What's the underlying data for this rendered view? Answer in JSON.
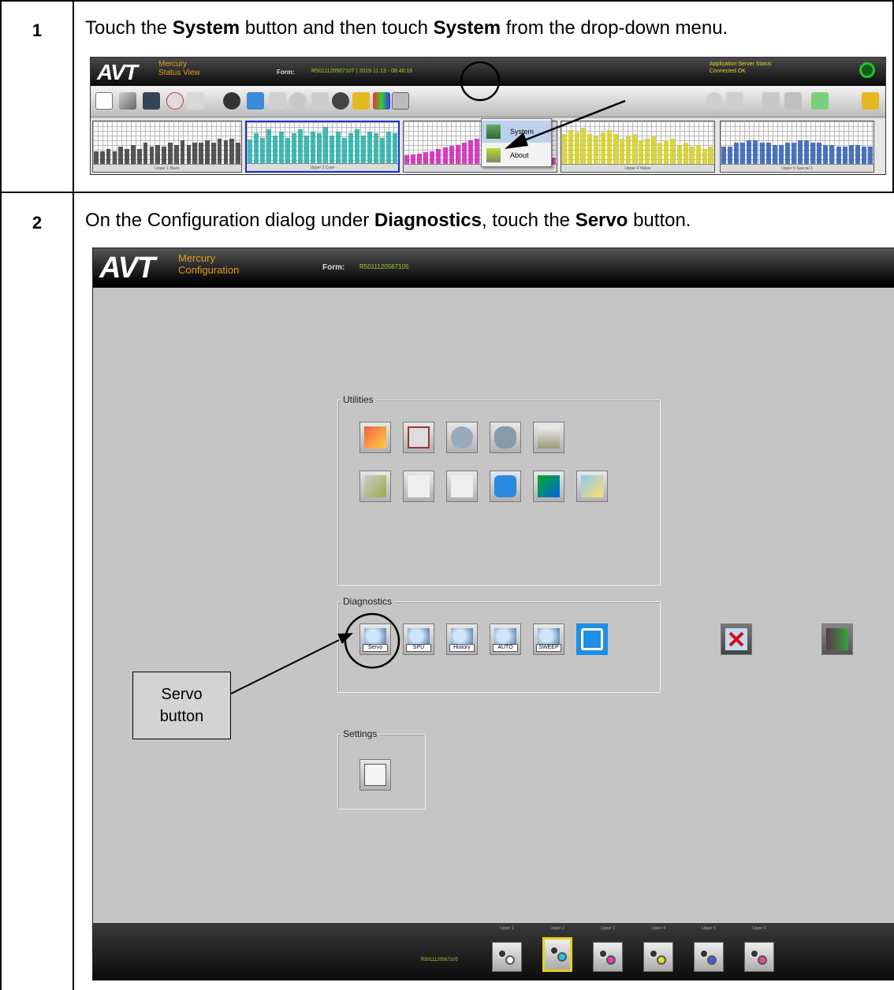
{
  "steps": [
    {
      "number": "1",
      "instruction": {
        "pre": "Touch the ",
        "b1": "System",
        "mid": " button and then touch ",
        "b2": "System",
        "post": " from the drop-down menu."
      }
    },
    {
      "number": "2",
      "instruction": {
        "pre": "On the Configuration dialog under ",
        "b1": "Diagnostics",
        "mid": ", touch the ",
        "b2": "Servo",
        "post": " button."
      }
    }
  ],
  "status_view": {
    "logo": "AVT",
    "app_line1": "Mercury",
    "app_line2": "Status View",
    "form_label": "Form:",
    "form_value": "R5011120567107 | 2019.11.13 - 08:46:16",
    "server_line1": "Application Server Status",
    "server_line2": "Connected OK",
    "chart_labels": [
      "Upper 1 Black",
      "Upper 2 Cyan",
      "",
      "Upper 4 Yellow",
      "Upper 5 Special 1"
    ],
    "chart_colors": [
      "#3a3a3a",
      "#1fb0a8",
      "#d21fb5",
      "#d6d01a",
      "#2c5cb6"
    ],
    "menu": {
      "system": "System",
      "about": "About"
    }
  },
  "configuration": {
    "logo": "AVT",
    "app_line1": "Mercury",
    "app_line2": "Configuration",
    "form_label": "Form:",
    "form_value": "R5011120567105",
    "groups": {
      "utilities": "Utilities",
      "diagnostics": "Diagnostics",
      "settings": "Settings"
    },
    "diagnostic_buttons": [
      "Servo",
      "SPU",
      "History",
      "AUTO",
      "SWEEP"
    ],
    "footer_id": "R5011120567105",
    "footer_units": [
      "Upper 1",
      "Upper 2",
      "Upper 3",
      "Upper 4",
      "Upper 5",
      "Upper 6"
    ],
    "unit_colors": [
      "#ffffff",
      "#25c8d8",
      "#e23bc0",
      "#e0dc2a",
      "#3a62d8",
      "#e04a9a"
    ]
  },
  "callout": {
    "line1": "Servo",
    "line2": "button"
  },
  "colors": {
    "accent_orange": "#e39b1c",
    "form_green": "#9ad234",
    "status_led": "#23c03a"
  }
}
